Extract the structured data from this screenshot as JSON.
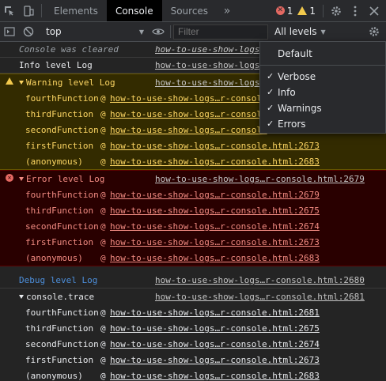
{
  "tabs": {
    "items": [
      "Elements",
      "Console",
      "Sources"
    ],
    "active": "Console",
    "more": "»"
  },
  "badges": {
    "errors": "1",
    "warnings": "1"
  },
  "toolbar": {
    "context": "top",
    "filter_placeholder": "Filter",
    "levels": "All levels"
  },
  "menu": {
    "default": "Default",
    "items": [
      {
        "label": "Verbose",
        "checked": true
      },
      {
        "label": "Info",
        "checked": true
      },
      {
        "label": "Warnings",
        "checked": true
      },
      {
        "label": "Errors",
        "checked": true
      }
    ]
  },
  "console": {
    "cleared": {
      "text": "Console was cleared",
      "src": "how-to-use-show-logs"
    },
    "info": {
      "text": "Info level Log",
      "src": "how-to-use-show-logs"
    },
    "warning": {
      "text": "Warning level Log",
      "src": "how-to-use-show-logs",
      "frames": [
        {
          "fn": "fourthFunction",
          "at": "@",
          "link": "how-to-use-show-logs…r-console"
        },
        {
          "fn": "thirdFunction",
          "at": "@",
          "link": "how-to-use-show-logs…r-console"
        },
        {
          "fn": "secondFunction",
          "at": "@",
          "link": "how-to-use-show-logs…r-console"
        },
        {
          "fn": "firstFunction",
          "at": "@",
          "link": "how-to-use-show-logs…r-console.html:2673"
        },
        {
          "fn": "(anonymous)",
          "at": "@",
          "link": "how-to-use-show-logs…r-console.html:2683"
        }
      ]
    },
    "error": {
      "text": "Error level Log",
      "src": "how-to-use-show-logs…r-console.html:2679",
      "frames": [
        {
          "fn": "fourthFunction",
          "at": "@",
          "link": "how-to-use-show-logs…r-console.html:2679"
        },
        {
          "fn": "thirdFunction",
          "at": "@",
          "link": "how-to-use-show-logs…r-console.html:2675"
        },
        {
          "fn": "secondFunction",
          "at": "@",
          "link": "how-to-use-show-logs…r-console.html:2674"
        },
        {
          "fn": "firstFunction",
          "at": "@",
          "link": "how-to-use-show-logs…r-console.html:2673"
        },
        {
          "fn": "(anonymous)",
          "at": "@",
          "link": "how-to-use-show-logs…r-console.html:2683"
        }
      ]
    },
    "debug": {
      "text": "Debug level Log",
      "src": "how-to-use-show-logs…r-console.html:2680"
    },
    "trace": {
      "text": "console.trace",
      "src": "how-to-use-show-logs…r-console.html:2681",
      "frames": [
        {
          "fn": "fourthFunction",
          "at": "@",
          "link": "how-to-use-show-logs…r-console.html:2681"
        },
        {
          "fn": "thirdFunction",
          "at": "@",
          "link": "how-to-use-show-logs…r-console.html:2675"
        },
        {
          "fn": "secondFunction",
          "at": "@",
          "link": "how-to-use-show-logs…r-console.html:2674"
        },
        {
          "fn": "firstFunction",
          "at": "@",
          "link": "how-to-use-show-logs…r-console.html:2673"
        },
        {
          "fn": "(anonymous)",
          "at": "@",
          "link": "how-to-use-show-logs…r-console.html:2683"
        }
      ]
    }
  }
}
